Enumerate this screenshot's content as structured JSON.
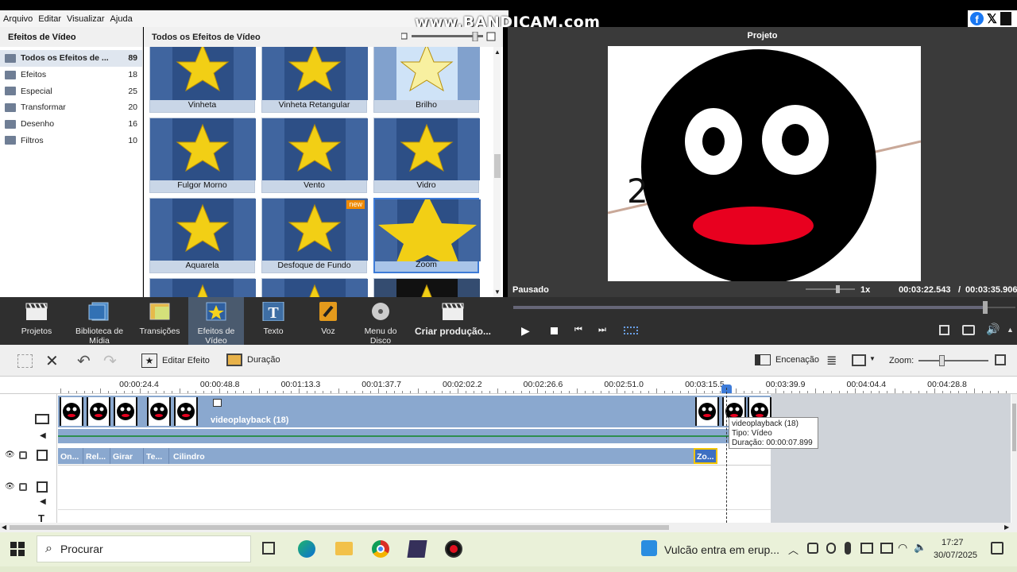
{
  "menu": [
    "Arquivo",
    "Editar",
    "Visualizar",
    "Ajuda"
  ],
  "watermark": "www.BANDICAM.com",
  "categories_panel": {
    "title": "Efeitos de Vídeo",
    "items": [
      {
        "label": "Todos os Efeitos de ...",
        "count": "89"
      },
      {
        "label": "Efeitos",
        "count": "18"
      },
      {
        "label": "Especial",
        "count": "25"
      },
      {
        "label": "Transformar",
        "count": "20"
      },
      {
        "label": "Desenho",
        "count": "16"
      },
      {
        "label": "Filtros",
        "count": "10"
      }
    ]
  },
  "effects_panel": {
    "title": "Todos os Efeitos de Vídeo",
    "tiles": [
      {
        "label": "Vinheta"
      },
      {
        "label": "Vinheta Retangular"
      },
      {
        "label": "Brilho"
      },
      {
        "label": "Fulgor Morno"
      },
      {
        "label": "Vento"
      },
      {
        "label": "Vidro"
      },
      {
        "label": "Aquarela"
      },
      {
        "label": "Desfoque de Fundo",
        "badge": "new"
      },
      {
        "label": "Zoom"
      },
      {
        "label": ""
      },
      {
        "label": ""
      },
      {
        "label": ""
      }
    ]
  },
  "preview": {
    "title": "Projeto",
    "state": "Pausado",
    "speed": "1x",
    "time_current": "00:03:22.543",
    "time_sep": "/",
    "time_total": "00:03:35.906",
    "image_text": "2",
    "progress": 0.94
  },
  "toolbar": {
    "items": [
      "Projetos",
      "Biblioteca de Mídia",
      "Transições",
      "Efeitos de Vídeo",
      "Texto",
      "Voz",
      "Menu do Disco"
    ],
    "create_label": "Criar produção..."
  },
  "timeline_tools": {
    "edit_effect": "Editar Efeito",
    "duration": "Duração",
    "staging": "Encenação",
    "zoom_label": "Zoom:"
  },
  "ruler": [
    "00:00:24.4",
    "00:00:48.8",
    "00:01:13.3",
    "00:01:37.7",
    "00:02:02.2",
    "00:02:26.6",
    "00:02:51.0",
    "00:03:15.5",
    "00:03:39.9",
    "00:04:04.4",
    "00:04:28.8"
  ],
  "clip": {
    "label": "videoplayback (18)"
  },
  "tooltip": {
    "name": "videoplayback (18)",
    "type": "Tipo: Vídeo",
    "duration": "Duração: 00:00:07.899"
  },
  "effect_track": [
    "On...",
    "Rel...",
    "Girar",
    "Te...",
    "Cilindro",
    "Zo..."
  ],
  "taskbar": {
    "search_placeholder": "Procurar",
    "news": "Vulcão entra em erup...",
    "time": "17:27",
    "date": "30/07/2025"
  },
  "colors": {
    "accent": "#3d7bd8",
    "toolbar": "#2f2f2f",
    "clip": "#8aa8cf",
    "taskbar": "#eaf1d9"
  }
}
